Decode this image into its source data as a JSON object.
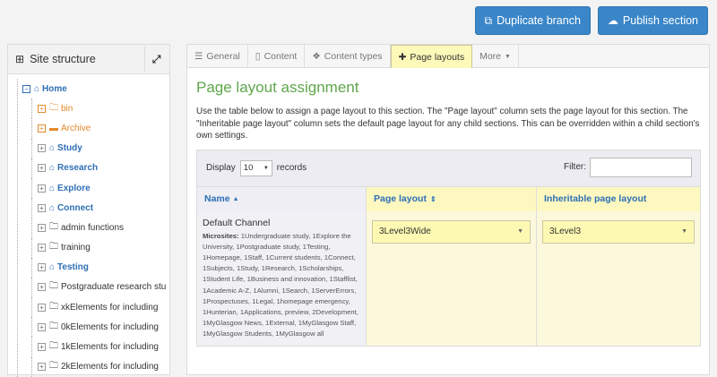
{
  "actions": {
    "duplicate_label": "Duplicate branch",
    "publish_label": "Publish section"
  },
  "sidebar": {
    "title": "Site structure",
    "root_label": "Home",
    "items": [
      {
        "label": "bin",
        "style": "orange",
        "icon": "folder"
      },
      {
        "label": "Archive",
        "style": "orange",
        "icon": "archive"
      },
      {
        "label": "Study",
        "style": "bold",
        "icon": "home"
      },
      {
        "label": "Research",
        "style": "bold",
        "icon": "home"
      },
      {
        "label": "Explore",
        "style": "bold",
        "icon": "home"
      },
      {
        "label": "Connect",
        "style": "bold",
        "icon": "home"
      },
      {
        "label": "admin functions",
        "style": "plain",
        "icon": "folder"
      },
      {
        "label": "training",
        "style": "plain",
        "icon": "folder"
      },
      {
        "label": "Testing",
        "style": "bold",
        "icon": "home"
      },
      {
        "label": "Postgraduate research stu",
        "style": "plain",
        "icon": "folder"
      },
      {
        "label": "xkElements for including",
        "style": "plain",
        "icon": "folder"
      },
      {
        "label": "0kElements for including",
        "style": "plain",
        "icon": "folder"
      },
      {
        "label": "1kElements for including",
        "style": "plain",
        "icon": "folder"
      },
      {
        "label": "2kElements for including",
        "style": "plain",
        "icon": "folder"
      }
    ]
  },
  "tabs": [
    {
      "label": "General",
      "icon": "sliders"
    },
    {
      "label": "Content",
      "icon": "file"
    },
    {
      "label": "Content types",
      "icon": "cubes"
    },
    {
      "label": "Page layouts",
      "icon": "puzzle"
    },
    {
      "label": "More",
      "icon": "caret"
    }
  ],
  "main": {
    "title": "Page layout assignment",
    "description": "Use the table below to assign a page layout to this section. The \"Page layout\" column sets the page layout for this section. The \"Inheritable page layout\" column sets the default page layout for any child sections. This can be overridden within a child section's own settings."
  },
  "table": {
    "display_label": "Display",
    "records_value": "10",
    "records_label": "records",
    "filter_label": "Filter:",
    "filter_value": "",
    "headers": {
      "name": "Name",
      "layout": "Page layout",
      "inheritable": "Inheritable page layout"
    },
    "rows": [
      {
        "name": "Default Channel",
        "microsites_label": "Microsites:",
        "microsites": " 1Undergraduate study, 1Explore the University, 1Postgraduate study, 1Testing, 1Homepage, 1Staff, 1Current students, 1Connect, 1Subjects, 1Study, 1Research, 1Scholarships, 1Student Life, 1Business and innovation, 1Stafflist, 1Academic A-Z, 1Alumni, 1Search, 1ServerErrors, 1Prospectuses, 1Legal, 1homepage emergency, 1Hunterian, 1Applications, preview, 2Development, 1MyGlasgow News, 1External, 1MyGlasgow Staff, 1MyGlasgow Students, 1MyGlasgow all",
        "layout": "3Level3Wide",
        "inheritable": "3Level3"
      }
    ]
  }
}
